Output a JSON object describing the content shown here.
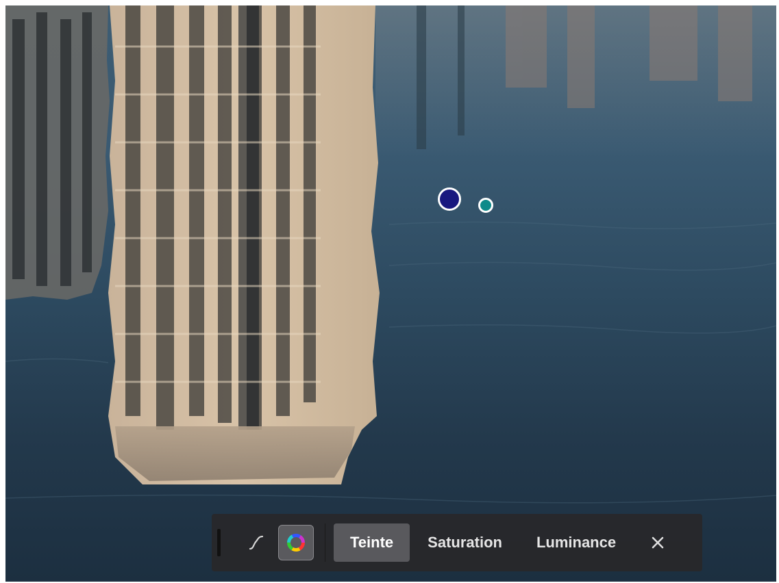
{
  "toolbar": {
    "tabs": [
      {
        "label": "Teinte",
        "active": true
      },
      {
        "label": "Saturation",
        "active": false
      },
      {
        "label": "Luminance",
        "active": false
      }
    ],
    "tools": [
      "curve-icon",
      "color-wheel-icon"
    ],
    "close_icon": "close-icon"
  },
  "colors": {
    "point_large": "#18187f",
    "point_small": "#0e8a8a",
    "toolbar_bg": "#28282a",
    "active_tab_bg": "#59595d"
  }
}
